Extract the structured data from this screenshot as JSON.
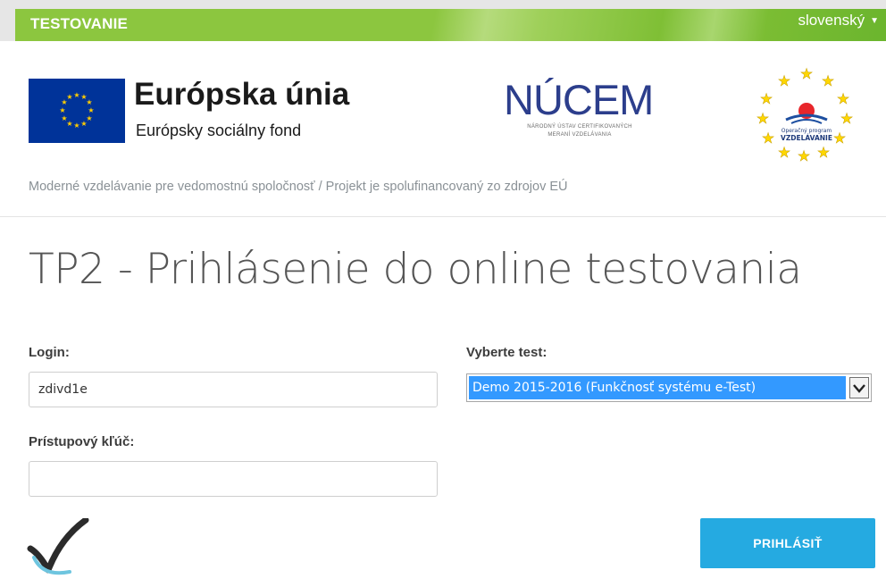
{
  "topbar": {
    "brand": "TESTOVANIE",
    "language": "slovenský"
  },
  "header": {
    "eu_title": "Európska únia",
    "eu_subtitle": "Európsky sociálny fond",
    "nucem_name": "NÚCEM",
    "nucem_line1": "NÁRODNÝ ÚSTAV CERTIFIKOVANÝCH",
    "nucem_line2": "MERANÍ VZDELÁVANIA",
    "op_logo_text": "Operačný program VZDELÁVANIE",
    "tagline": "Moderné vzdelávanie pre vedomostnú spoločnosť / Projekt je spolufinancovaný zo zdrojov EÚ"
  },
  "main": {
    "title": "TP2 - Prihlásenie do online testovania",
    "login_label": "Login:",
    "login_value": "zdivd1e",
    "access_key_label": "Prístupový kľúč:",
    "access_key_value": "",
    "test_label": "Vyberte test:",
    "test_selected": "Demo 2015-2016 (Funkčnosť systému e-Test)",
    "submit_label": "PRIHLÁSIŤ"
  },
  "colors": {
    "topbar_green": "#8cc63f",
    "button_blue": "#25aae1",
    "select_highlight": "#3399ff",
    "nucem_blue": "#2c3e8c"
  }
}
